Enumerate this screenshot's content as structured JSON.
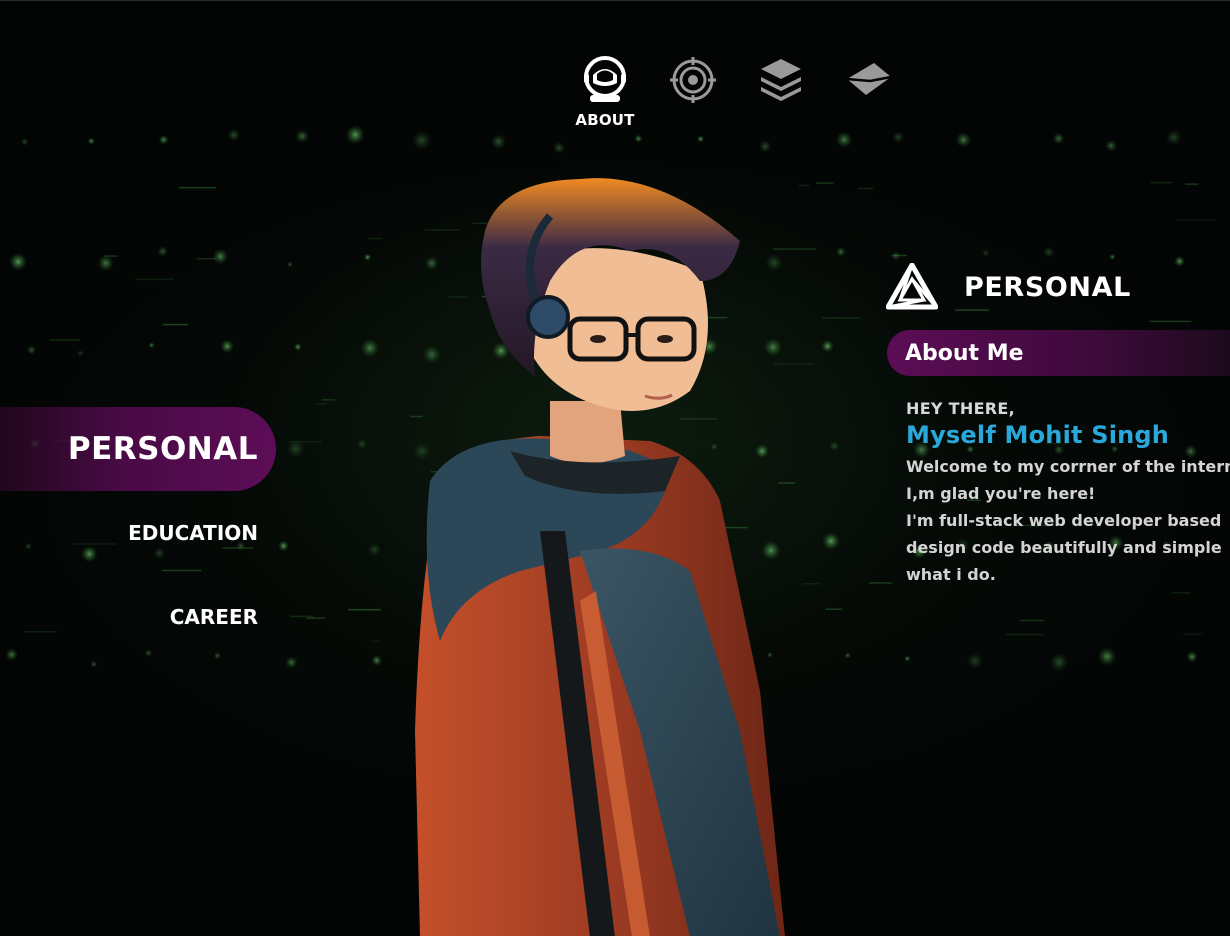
{
  "nav": {
    "items": [
      {
        "name": "about",
        "icon": "astronaut-helmet-icon",
        "label": "ABOUT",
        "active": true
      },
      {
        "name": "skills",
        "icon": "target-eye-icon",
        "label": "",
        "active": false
      },
      {
        "name": "projects",
        "icon": "layers-icon",
        "label": "",
        "active": false
      },
      {
        "name": "contact",
        "icon": "envelope-icon",
        "label": "",
        "active": false
      }
    ]
  },
  "sidenav": {
    "active": "PERSONAL",
    "items": [
      "EDUCATION",
      "CAREER"
    ]
  },
  "section": {
    "logo_icon": "penrose-triangle-icon",
    "title": "PERSONAL",
    "subtitle": "About Me"
  },
  "intro": {
    "greeting": "HEY THERE,",
    "name": "Myself Mohit Singh",
    "lines": [
      "Welcome to my corrner of the intern",
      "I,m glad you're here!",
      "I'm full-stack web developer based",
      "design code beautifully and simple",
      "what i do."
    ]
  },
  "colors": {
    "accent_purple": "#5c0d56",
    "name_blue": "#2aa8d9",
    "matrix_green": "#3fbf4a"
  }
}
